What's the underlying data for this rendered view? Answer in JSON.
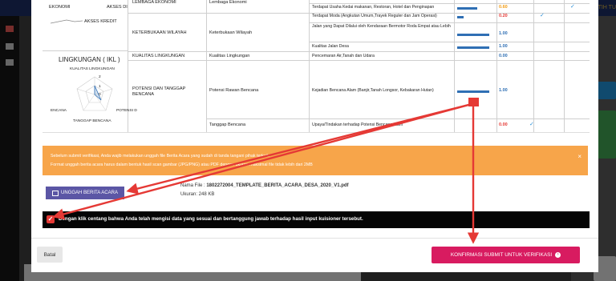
{
  "app": {
    "brand_text": "PUTIH TU"
  },
  "table": {
    "rows": [
      {
        "col1": "LEMBAGA EKONOMI",
        "col2": "Lembaga Ekonomi",
        "col3": "Terdapat Usaha Kedai makanan, Restoran, Hotel dan Penginapan",
        "value": "0.60",
        "value_color": "#f39c12"
      },
      {
        "col1": "",
        "col2": "",
        "col3": "Terdapat Moda (Angkutan Umum,Trayek Reguler dan Jam Operasi)",
        "value": "0.20",
        "value_color": "#e53935"
      },
      {
        "col1": "KETERBUKAAN WILAYAH",
        "col2": "Keterbukaan Wilayah",
        "col3": "Jalan yang Dapat Dilalui oleh Kendaraan Bermotor Roda Empat atau Lebih",
        "value": "1.00",
        "value_color": "#2f6fb4"
      },
      {
        "col1": "",
        "col2": "",
        "col3": "Kualitas Jalan Desa",
        "value": "1.00",
        "value_color": "#2f6fb4"
      },
      {
        "col1": "KUALITAS LINGKUNGAN",
        "col2": "Kualitas Lingkungan",
        "col3": "Pencemaran Air,Tanah dan Udara",
        "value": "0.00",
        "value_color": "#2f6fb4"
      },
      {
        "col1": "POTENSI DAN TANGGAP BENCANA",
        "col2": "Potensi Rawan Bencana",
        "col3": "Kejadian Bencana Alam (Banjir,Tanah Longsor, Kebakaran Hutan)",
        "value": "1.00",
        "value_color": "#2f6fb4"
      },
      {
        "col1": "",
        "col2": "Tanggap Bencana",
        "col3": "Upaya/Tindakan terhadap Potensi Bencana Alam",
        "value": "0.00",
        "value_color": "#e53935"
      }
    ],
    "left_panel": {
      "ekonomi_label": "EKONOMI",
      "akses_label": "AKSES DI",
      "akses_kredit": "AKSES KREDIT",
      "lingkungan_title": "LINGKUNGAN ( IKL )",
      "kualitas_label": "KUALITAS LINGKUNGAN",
      "radar_scale_2": "2",
      "radar_scale_1": "1",
      "radar_scale_0": "0",
      "bencana_left": "ENCANA",
      "potensi_right": "POTENSI D",
      "tanggap_bottom": "TANGGAP BENCANA"
    }
  },
  "alert": {
    "line1": "Sebelum submit verifikasi, Anda wajib melakukan unggah file Berita Acara yang sudah di tanda tangani pihak terkait.",
    "line2": "Format unggah berita acara harus dalam bentuk hasil scan gambar (JPG/PNG) atau PDF dengan ukuran maksimal file tidak lebih dari 2MB",
    "close": "×"
  },
  "upload": {
    "button_label": "UNGGAH BERITA ACARA",
    "file_label": "Nama File : ",
    "file_name": "1802272004_TEMPLATE_BERITA_ACARA_DESA_2020_V1.pdf",
    "size_text": "Ukuran: 248 KB"
  },
  "agreement": {
    "text": "Dengan klik centang bahwa Anda telah mengisi data yang sesuai dan bertanggung jawab terhadap hasil input kuisioner tersebut.",
    "checked": true
  },
  "footer": {
    "cancel_label": "Batal",
    "confirm_label": "KONFIRMASI SUBMIT UNTUK VERIFIKASI",
    "confirm_icon": "arrow-circle-right-icon"
  },
  "colors": {
    "confirm": "#d81b60",
    "upload": "#5b56a5",
    "alert": "#f7a54a",
    "annotation_arrow": "#e53935"
  }
}
